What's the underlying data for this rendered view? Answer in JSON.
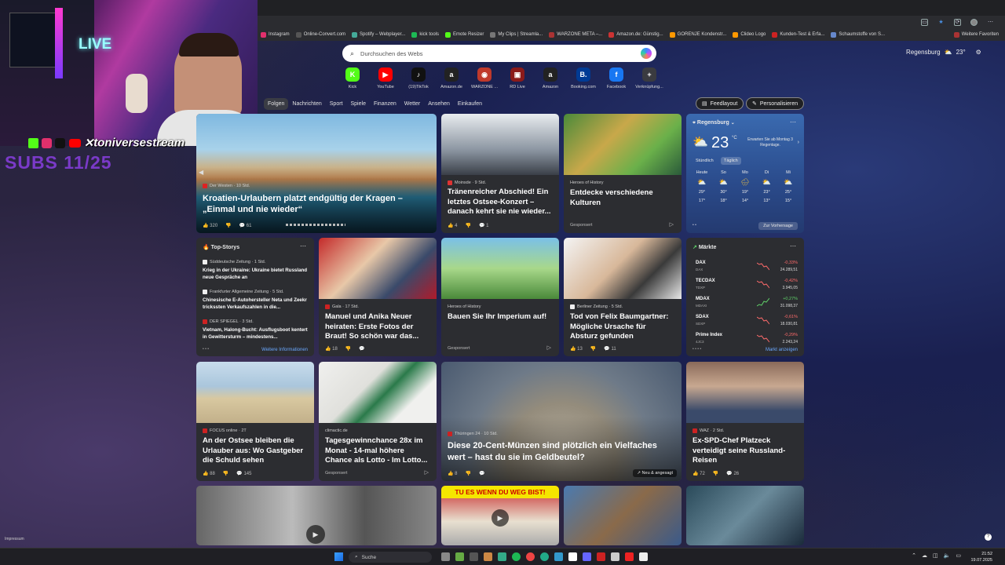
{
  "browser": {
    "bookmarks": [
      "Instagram",
      "Online-Convert.com",
      "Spotify – Webplayer...",
      "kick tools",
      "Emote Resizer",
      "My Clips | Streamla...",
      "WARZONE META –...",
      "Amazon.de: Günstig...",
      "GORENJE Kondenstr...",
      "Clideo Logo",
      "Kunden-Test & Erfa...",
      "Schaumstoffe von S...",
      "Weitere Favoriten"
    ]
  },
  "search": {
    "placeholder": "Durchsuchen des Webs"
  },
  "weather_top": {
    "city": "Regensburg",
    "temp": "23°"
  },
  "shortcuts": [
    {
      "label": "Kick",
      "glyph": "K",
      "color": "#53fc18"
    },
    {
      "label": "YouTube",
      "glyph": "▶",
      "color": "#ff0000"
    },
    {
      "label": "(19)TikTok",
      "glyph": "♪",
      "color": "#111111"
    },
    {
      "label": "Amazon.de",
      "glyph": "a",
      "color": "#222222"
    },
    {
      "label": "WARZONE ...",
      "glyph": "◉",
      "color": "#c0392b"
    },
    {
      "label": "RD Live",
      "glyph": "▣",
      "color": "#8b1a1a"
    },
    {
      "label": "Amazon",
      "glyph": "a",
      "color": "#222222"
    },
    {
      "label": "Booking.com",
      "glyph": "B.",
      "color": "#003b95"
    },
    {
      "label": "Facebook",
      "glyph": "f",
      "color": "#1877f2"
    },
    {
      "label": "Verknüpfung...",
      "glyph": "+",
      "color": "#3a3b40"
    }
  ],
  "nav": {
    "tabs": [
      "Folgen",
      "Nachrichten",
      "Sport",
      "Spiele",
      "Finanzen",
      "Wetter",
      "Ansehen",
      "Einkaufen"
    ],
    "feedlayout": "Feedlayout",
    "personalize": "Personalisieren"
  },
  "cards": {
    "hero": {
      "source": "Der Westen · 10 Std.",
      "title": "Kroatien-Urlaubern platzt endgültig der Kragen – „Einmal und nie wieder“",
      "likes": "320",
      "comments": "61"
    },
    "moin": {
      "source": "Moinsde · 9 Std.",
      "title": "Tränenreicher Abschied! Ein letztes Ostsee-Konzert – danach kehrt sie nie wieder...",
      "likes": "4",
      "comments": "1"
    },
    "heroes1": {
      "source": "Heroes of History",
      "title": "Entdecke verschiedene Kulturen",
      "sponsored": "Gesponsert"
    },
    "gala": {
      "source": "Gala · 17 Std.",
      "title": "Manuel und Anika Neuer heiraten: Erste Fotos der Braut! So schön war das...",
      "likes": "18"
    },
    "heroes2": {
      "source": "Heroes of History",
      "title": "Bauen Sie Ihr Imperium auf!",
      "sponsored": "Gesponsert"
    },
    "berliner": {
      "source": "Berliner Zeitung · 5 Std.",
      "title": "Tod von Felix Baumgartner: Mögliche Ursache für Absturz gefunden",
      "likes": "13",
      "comments": "11"
    },
    "focus": {
      "source": "FOCUS online · 2T",
      "title": "An der Ostsee bleiben die Urlauber aus: Wo Gastgeber die Schuld sehen",
      "likes": "88",
      "comments": "145"
    },
    "climactic": {
      "source": "climactic.de",
      "title": "Tagesgewinnchance 28x im Monat - 14-mal höhere Chance als Lotto - Im Lotto...",
      "sponsored": "Gesponsert"
    },
    "coin": {
      "source": "Thüringen 24 · 10 Std.",
      "title": "Diese 20-Cent-Münzen sind plötzlich ein Vielfaches wert – hast du sie im Geldbeutel?",
      "likes": "8",
      "badge": "Neu & angesagt"
    },
    "waz": {
      "source": "WAZ · 2 Std.",
      "title": "Ex-SPD-Chef Platzeck verteidigt seine Russland-Reisen",
      "likes": "72",
      "comments": "26"
    },
    "video_banner": "TU ES WENN DU WEG BIST!"
  },
  "topstories": {
    "header": "Top-Storys",
    "items": [
      {
        "source": "Süddeutsche Zeitung · 1 Std.",
        "title": "Krieg in der Ukraine: Ukraine bietet Russland neue Gespräche an"
      },
      {
        "source": "Frankfurter Allgemeine Zeitung · 5 Std.",
        "title": "Chinesische E-Autohersteller Neta und Zeekr trickssten Verkaufszahlen in die..."
      },
      {
        "source": "DER SPIEGEL · 3 Std.",
        "title": "Vietnam, Halong-Bucht: Ausflugsboot kentert in Gewittersturm – mindestens..."
      }
    ],
    "more": "Weitere Informationen"
  },
  "weather_card": {
    "city": "Regensburg",
    "temp": "23",
    "unit": "°C",
    "note": "Erwarten Sie ab Montag 3 Regentage.",
    "tab_hourly": "Stündlich",
    "tab_daily": "Täglich",
    "days": [
      {
        "day": "Heute",
        "hi": "29°",
        "lo": "17°"
      },
      {
        "day": "So",
        "hi": "30°",
        "lo": "18°"
      },
      {
        "day": "Mo",
        "hi": "19°",
        "lo": "14°"
      },
      {
        "day": "Di",
        "hi": "23°",
        "lo": "13°"
      },
      {
        "day": "Mi",
        "hi": "25°",
        "lo": "15°"
      }
    ],
    "forecast_btn": "Zur Vorhersage"
  },
  "markets": {
    "header": "Märkte",
    "items": [
      {
        "name": "DAX",
        "sub": "DAX",
        "change": "-0,33%",
        "value": "24.289,51",
        "color": "#ff6b6b"
      },
      {
        "name": "TECDAX",
        "sub": "TDXP",
        "change": "-0,42%",
        "value": "3.945,05",
        "color": "#ff6b6b"
      },
      {
        "name": "MDAX",
        "sub": "MDAXI",
        "change": "+0,27%",
        "value": "31.098,37",
        "color": "#5fd068"
      },
      {
        "name": "SDAX",
        "sub": "SDXP",
        "change": "-0,61%",
        "value": "18.030,81",
        "color": "#ff6b6b"
      },
      {
        "name": "Prime Index",
        "sub": "4JC3",
        "change": "-0,29%",
        "value": "2.243,24",
        "color": "#ff6b6b"
      }
    ],
    "more": "Markt anzeigen"
  },
  "stream": {
    "handle": "toniversestream",
    "subs": "SUBS 11/25",
    "live": "LIVE"
  },
  "footer": {
    "impressum": "Impressum"
  },
  "taskbar": {
    "search": "Suche",
    "time": "21:52",
    "date": "19.07.2025"
  }
}
